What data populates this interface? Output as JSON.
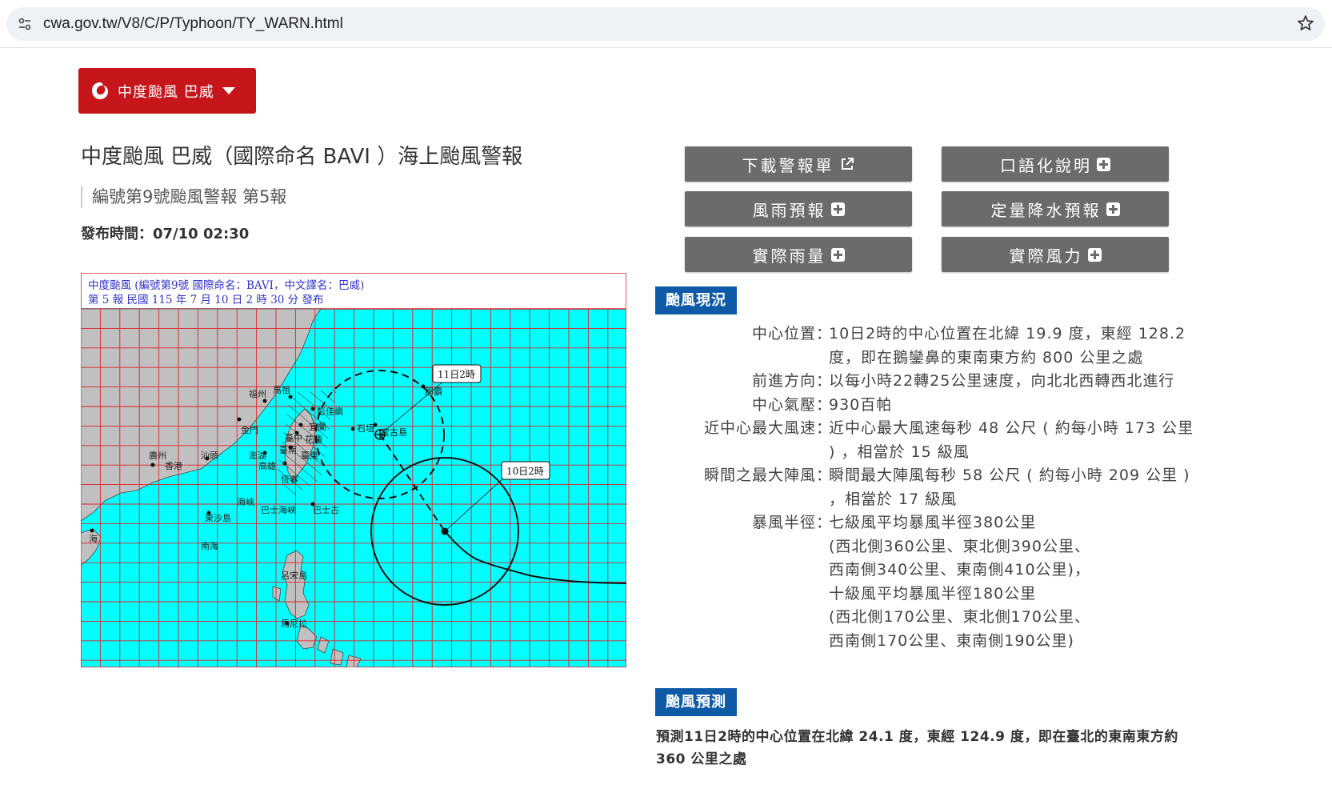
{
  "browser": {
    "url": "cwa.gov.tw/V8/C/P/Typhoon/TY_WARN.html"
  },
  "selector": {
    "label": "中度颱風 巴威"
  },
  "header": {
    "title": "中度颱風 巴威（國際命名 BAVI ）海上颱風警報",
    "subtitle": "編號第9號颱風警報 第5報",
    "publish_time": "發布時間：07/10 02:30"
  },
  "map": {
    "header_line1": "中度颱風  (編號第9號  國際命名：BAVI，中文譯名：巴威)",
    "header_line2": "第 5 報  民國 115 年 7 月 10 日 2 時 30 分 發布",
    "label_forecast": "11日2時",
    "label_current": "10日2時",
    "place_names": {
      "fuzhou": "福州",
      "mazu": "馬祖",
      "kinmen": "金門",
      "penghu": "澎湖",
      "taiwan": "臺",
      "taichung": "臺中",
      "tainan": "臺南",
      "kaohsiung": "高雄",
      "hengchun": "恆春",
      "hualien": "花蓮",
      "yilan": "宜蘭",
      "taitung": "臺東",
      "pengjiayu": "彭佳嶼",
      "ishigaki": "石垣",
      "miyako": "宮古島",
      "naha": "那霸",
      "guangzhou": "廣州",
      "hongkong": "香港",
      "shantou": "汕頭",
      "dongsha": "東沙島",
      "hainan": "海",
      "luzon": "呂宋島",
      "manila": "馬尼拉",
      "bashi": "巴士海峽",
      "lanyu": "蘭",
      "south_sea": "南海",
      "strait": "海峽",
      "basco": "巴士古"
    }
  },
  "buttons": {
    "download": "下載警報單",
    "oral": "口語化說明",
    "wind_rain": "風雨預報",
    "qpf": "定量降水預報",
    "actual_rain": "實際雨量",
    "actual_wind": "實際風力"
  },
  "sections": {
    "current": "颱風現況",
    "forecast": "颱風預測"
  },
  "current_status": [
    {
      "key": "中心位置",
      "value": "10日2時的中心位置在北緯 19.9 度，東經 128.2 度，即在鵝鑾鼻的東南東方約 800 公里之處"
    },
    {
      "key": "前進方向",
      "value": "以每小時22轉25公里速度，向北北西轉西北進行"
    },
    {
      "key": "中心氣壓",
      "value": "930百帕"
    },
    {
      "key": "近中心最大風速",
      "value": "近中心最大風速每秒 48 公尺 ( 約每小時 173 公里 ) ，相當於 15 級風"
    },
    {
      "key": "瞬間之最大陣風",
      "value": "瞬間最大陣風每秒 58 公尺 ( 約每小時 209 公里 ) ，相當於 17 級風"
    },
    {
      "key": "暴風半徑",
      "value_lines": [
        "七級風平均暴風半徑380公里",
        "(西北側360公里、東北側390公里、",
        "西南側340公里、東南側410公里)，",
        "十級風平均暴風半徑180公里",
        "(西北側170公里、東北側170公里、",
        "西南側170公里、東南側190公里)"
      ]
    }
  ],
  "forecast_text": "預測11日2時的中心位置在北緯 24.1 度，東經 124.9 度，即在臺北的東南東方約 360 公里之處",
  "colors": {
    "brand_red": "#c6161b",
    "button_gray": "#6b6b6b",
    "section_blue": "#0e5aa7",
    "sea": "#00ffff",
    "grid": "#e0202a"
  }
}
